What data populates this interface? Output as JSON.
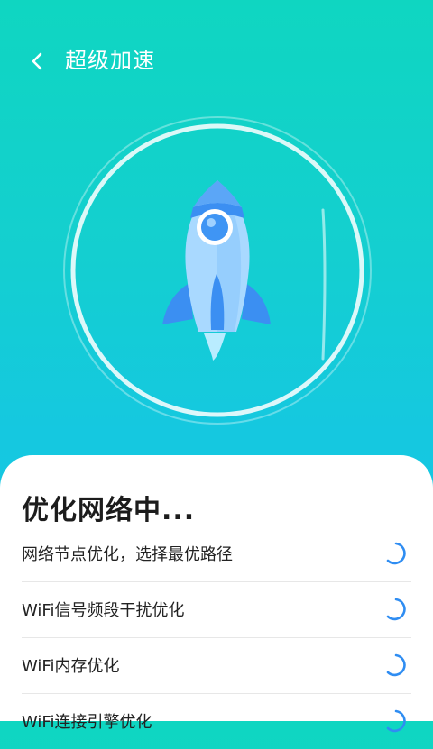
{
  "header": {
    "title": "超级加速"
  },
  "status": {
    "heading": "优化网络中..."
  },
  "tasks": [
    {
      "label": "网络节点优化，选择最优路径"
    },
    {
      "label": "WiFi信号频段干扰优化"
    },
    {
      "label": "WiFi内存优化"
    },
    {
      "label": "WiFi连接引擎优化"
    }
  ],
  "colors": {
    "gradient_top": "#0fd6c1",
    "gradient_bottom": "#16c3e8",
    "spinner": "#2f8df2",
    "rocket_blue": "#3b8ff2"
  },
  "icons": {
    "back": "chevron-left-icon",
    "hero": "rocket-icon",
    "loading": "spinner-icon"
  }
}
